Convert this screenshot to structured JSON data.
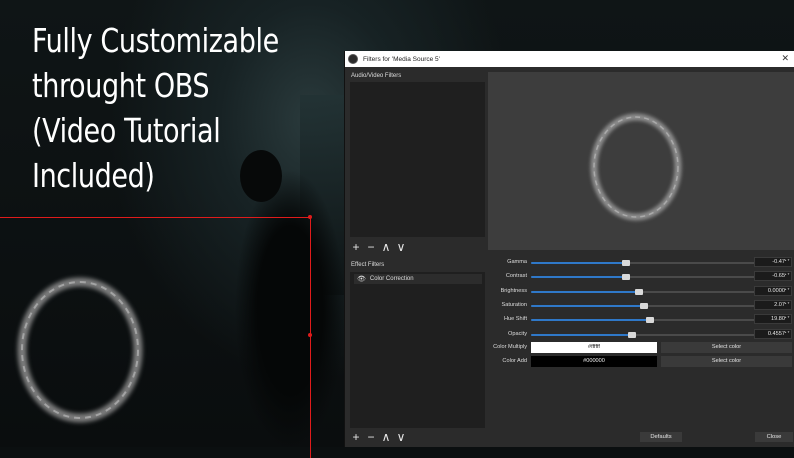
{
  "headline": {
    "lines": [
      "Fully Customizable",
      "throught OBS",
      "(Video Tutorial",
      "Included)"
    ]
  },
  "colors": {
    "accent_red": "#e01b1b",
    "slider_blue": "#2f78c8",
    "dialog_bg": "#2b2b2b"
  },
  "dialog": {
    "title": "Filters for 'Media Source 5'",
    "close_glyph": "✕",
    "audio_video_filters_label": "Audio/Video Filters",
    "effect_filters_label": "Effect Filters",
    "effect_filters": [
      {
        "name": "Color Correction",
        "visible": true
      }
    ],
    "toolbar_glyphs": {
      "add": "+",
      "remove": "−",
      "up": "∧",
      "down": "∨"
    },
    "properties": [
      {
        "label": "Gamma",
        "value": "-0.47",
        "level": 0.42
      },
      {
        "label": "Contrast",
        "value": "-0.65",
        "level": 0.42
      },
      {
        "label": "Brightness",
        "value": "0.0000",
        "level": 0.48
      },
      {
        "label": "Saturation",
        "value": "2.07",
        "level": 0.5
      },
      {
        "label": "Hue Shift",
        "value": "19.80",
        "level": 0.53
      },
      {
        "label": "Opacity",
        "value": "0.4557",
        "level": 0.45
      }
    ],
    "color_multiply": {
      "label": "Color Multiply",
      "value": "#ffffff",
      "button": "Select color"
    },
    "color_add": {
      "label": "Color Add",
      "value": "#000000",
      "button": "Select color"
    },
    "defaults_button": "Defaults",
    "close_button": "Close"
  }
}
